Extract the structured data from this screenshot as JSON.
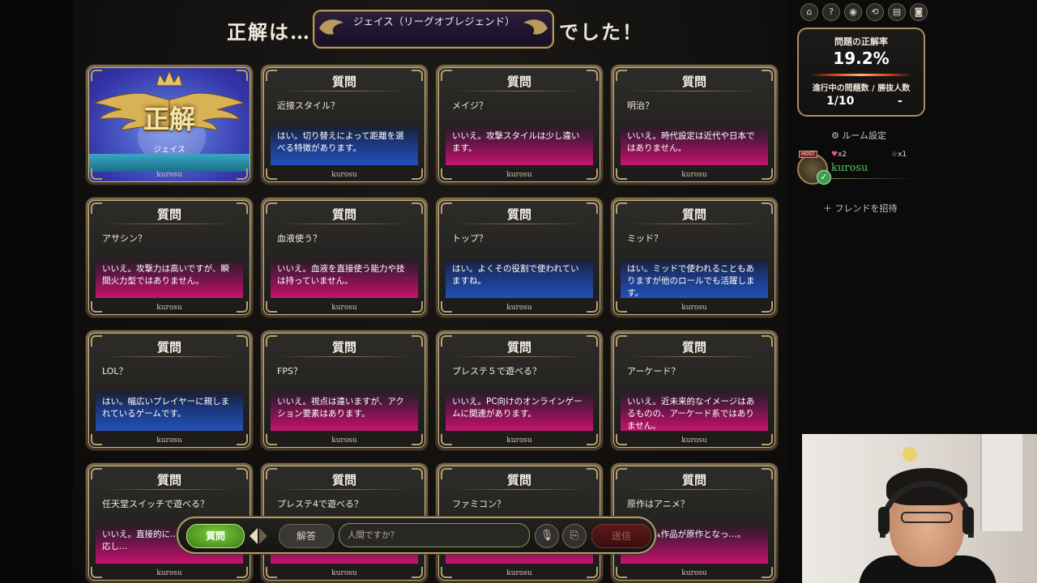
{
  "header": {
    "prefix": "正解は…",
    "answer": "ジェイス（リーグオブレジェンド）",
    "suffix": "でした！"
  },
  "correct_card": {
    "label": "正解",
    "name": "ジェイス",
    "author": "kurosu"
  },
  "cards": [
    {
      "title": "質問",
      "question": "近接スタイル？",
      "answer": "はい。切り替えによって距離を選べる特徴があります。",
      "result": "yes",
      "author": "kurosu"
    },
    {
      "title": "質問",
      "question": "メイジ？",
      "answer": "いいえ。攻撃スタイルは少し違います。",
      "result": "no",
      "author": "kurosu"
    },
    {
      "title": "質問",
      "question": "明治？",
      "answer": "いいえ。時代設定は近代や日本ではありません。",
      "result": "no",
      "author": "kurosu"
    },
    {
      "title": "質問",
      "question": "アサシン？",
      "answer": "いいえ。攻撃力は高いですが、瞬間火力型ではありません。",
      "result": "no",
      "author": "kurosu"
    },
    {
      "title": "質問",
      "question": "血液使う？",
      "answer": "いいえ。血液を直接使う能力や技は持っていません。",
      "result": "no",
      "author": "kurosu"
    },
    {
      "title": "質問",
      "question": "トップ？",
      "answer": "はい。よくその役割で使われていますね。",
      "result": "yes",
      "author": "kurosu"
    },
    {
      "title": "質問",
      "question": "ミッド？",
      "answer": "はい。ミッドで使われることもありますが他のロールでも活躍します。",
      "result": "yes",
      "author": "kurosu"
    },
    {
      "title": "質問",
      "question": "LOL？",
      "answer": "はい。幅広いプレイヤーに親しまれているゲームです。",
      "result": "yes",
      "author": "kurosu"
    },
    {
      "title": "質問",
      "question": "FPS？",
      "answer": "いいえ。視点は違いますが、アクション要素はあります。",
      "result": "no",
      "author": "kurosu"
    },
    {
      "title": "質問",
      "question": "プレステ５で遊べる？",
      "answer": "いいえ。PC向けのオンラインゲームに関連があります。",
      "result": "no",
      "author": "kurosu"
    },
    {
      "title": "質問",
      "question": "アーケード？",
      "answer": "いいえ。近未来的なイメージはあるものの、アーケード系ではありません。",
      "result": "no",
      "author": "kurosu"
    },
    {
      "title": "質問",
      "question": "任天堂スイッチで遊べる？",
      "answer": "いいえ。直接的に…ォームには対応し…",
      "result": "no",
      "author": "kurosu"
    },
    {
      "title": "質問",
      "question": "プレステ4で遊べる？",
      "answer": "",
      "result": "no",
      "author": "kurosu"
    },
    {
      "title": "質問",
      "question": "ファミコン？",
      "answer": "",
      "result": "no",
      "author": "kurosu"
    },
    {
      "title": "質問",
      "question": "原作はアニメ？",
      "answer": "…ゲーム作品が原作となっ…。",
      "result": "no",
      "author": "kurosu"
    }
  ],
  "sidebar": {
    "icons": [
      "home-icon",
      "help-icon",
      "settings-icon",
      "share-icon",
      "document-icon",
      "discord-icon"
    ],
    "icon_glyphs": [
      "⌂",
      "?",
      "◉",
      "⟲",
      "▤",
      "◙"
    ],
    "correct_rate_label": "問題の正解率",
    "correct_rate": "19.2%",
    "progress_label": "進行中の問題数 / 勝抜人数",
    "progress": "1/10",
    "winners": "-",
    "room_settings": "ルーム設定",
    "player": {
      "host_tag": "HOST",
      "name": "kurosu",
      "hearts": "x2",
      "stars": "x1"
    },
    "invite": "フレンドを招待"
  },
  "inputbar": {
    "question_button": "質問",
    "answer_button": "解答",
    "placeholder": "人間ですか？",
    "send_button": "送信"
  },
  "colors": {
    "yes_answer": "#1f4aa8",
    "no_answer": "#a6125f",
    "gold_border": "#b39c6b",
    "player_name": "#58c45a"
  }
}
